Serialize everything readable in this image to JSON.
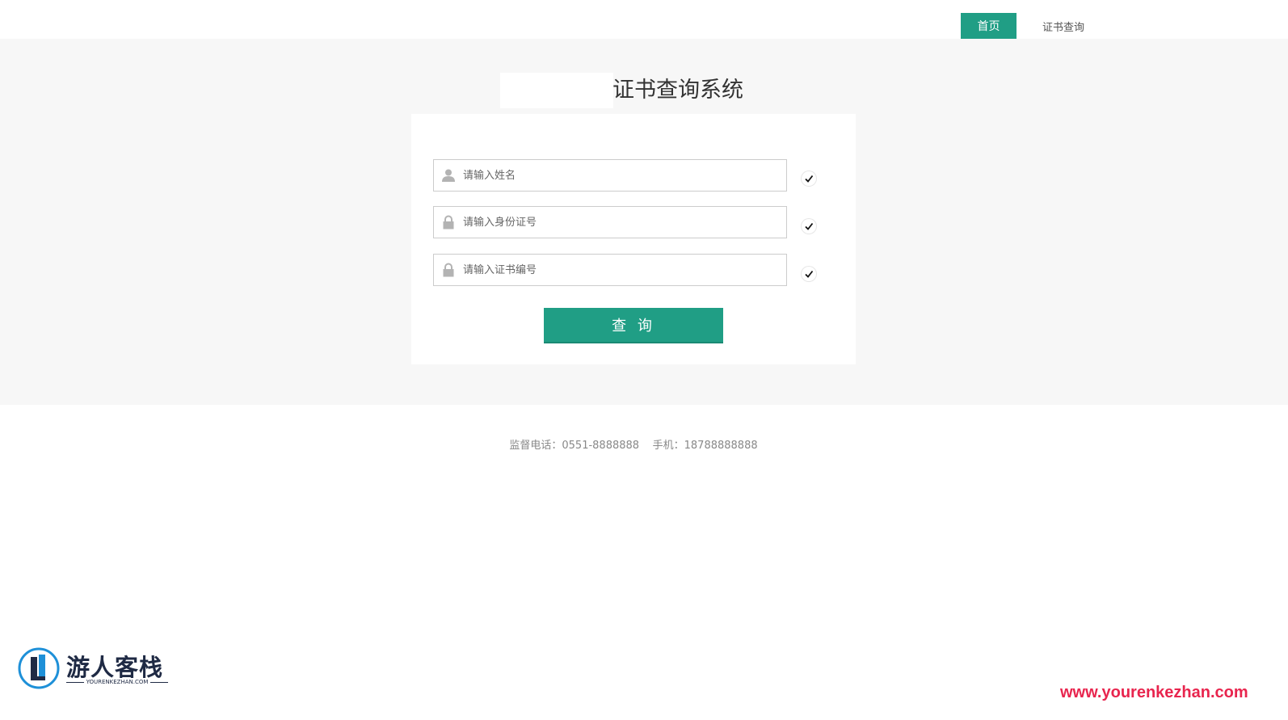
{
  "nav": {
    "home_label": "首页",
    "query_label": "证书查询"
  },
  "main": {
    "title": "证书查询系统"
  },
  "form": {
    "name_placeholder": "请输入姓名",
    "id_placeholder": "请输入身份证号",
    "cert_placeholder": "请输入证书编号",
    "submit_label": "查 询"
  },
  "footer": {
    "phone_label": "监督电话：",
    "phone_value": "0551-8888888",
    "mobile_label": "手机：",
    "mobile_value": "18788888888"
  },
  "watermark": {
    "brand": "游人客栈",
    "brand_sub": "YOURENKEZHAN.COM",
    "url": "www.yourenkezhan.com"
  },
  "colors": {
    "accent": "#209e85",
    "band_bg": "#f7f7f7",
    "watermark_url": "#e8254e"
  },
  "icons": {
    "name_field": "user-icon",
    "id_field": "lock-icon",
    "cert_field": "lock-icon",
    "validation": "check-icon"
  }
}
